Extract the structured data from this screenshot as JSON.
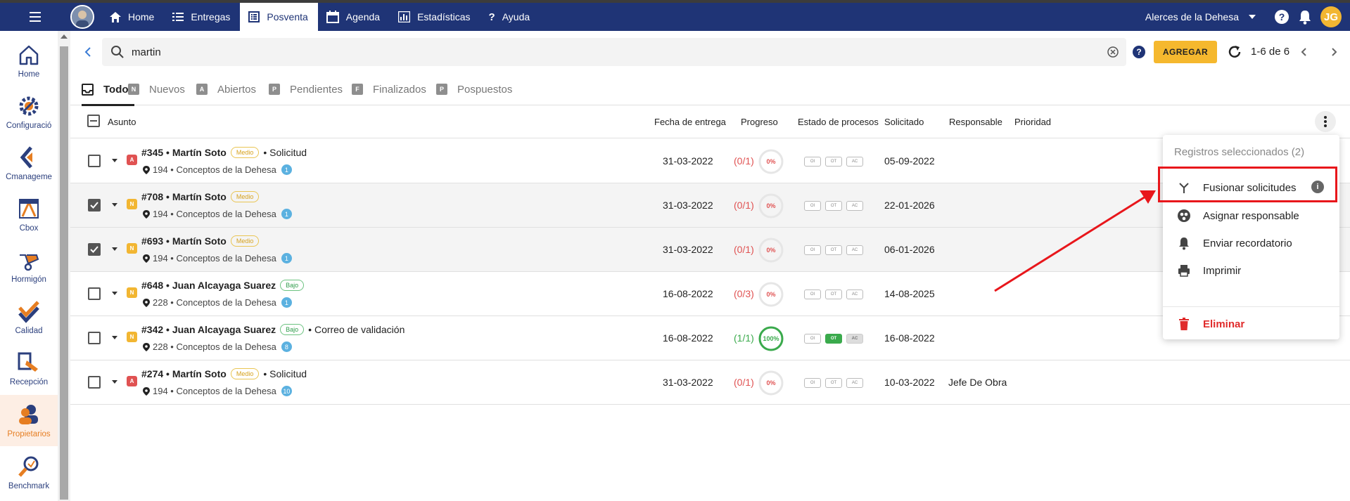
{
  "topbar": {
    "nav": [
      {
        "label": "Home",
        "icon": "home-icon"
      },
      {
        "label": "Entregas",
        "icon": "list-icon"
      },
      {
        "label": "Posventa",
        "icon": "document-icon",
        "active": true
      },
      {
        "label": "Agenda",
        "icon": "calendar-icon"
      },
      {
        "label": "Estadísticas",
        "icon": "chart-icon"
      },
      {
        "label": "Ayuda",
        "icon": "question-icon"
      }
    ],
    "company": "Alerces de la Dehesa",
    "user_initials": "JG",
    "brand_color": "#1f3476"
  },
  "sidebar": {
    "items": [
      {
        "label": "Home"
      },
      {
        "label": "Configuració"
      },
      {
        "label": "Cmanageme"
      },
      {
        "label": "Cbox"
      },
      {
        "label": "Hormigón"
      },
      {
        "label": "Calidad"
      },
      {
        "label": "Recepción"
      },
      {
        "label": "Propietarios",
        "active": true
      },
      {
        "label": "Benchmark"
      }
    ]
  },
  "search": {
    "value": "martin",
    "add_label": "AGREGAR",
    "pager": "1-6 de 6"
  },
  "tabs": [
    {
      "label": "Todos",
      "badge": "",
      "active": true
    },
    {
      "label": "Nuevos",
      "badge": "N"
    },
    {
      "label": "Abiertos",
      "badge": "A"
    },
    {
      "label": "Pendientes",
      "badge": "P"
    },
    {
      "label": "Finalizados",
      "badge": "F"
    },
    {
      "label": "Pospuestos",
      "badge": "P"
    }
  ],
  "columns": {
    "asunto": "Asunto",
    "fecha": "Fecha de entrega",
    "progreso": "Progreso",
    "estado": "Estado de procesos",
    "solicitado": "Solicitado",
    "responsable": "Responsable",
    "prioridad": "Prioridad"
  },
  "rows": [
    {
      "checked": false,
      "prio": "A",
      "id": "#345 • Martín Soto",
      "tag": "Medio",
      "extra": "• Solicitud",
      "unit": "194 • Conceptos de la Dehesa",
      "count": "1",
      "fecha": "31-03-2022",
      "prog_text": "(0/1)",
      "prog_pct": "0%",
      "prog_value": 0,
      "procs": [
        "OI",
        "OT",
        "AC"
      ],
      "proc_states": [
        "off",
        "off",
        "off"
      ],
      "solicitado": "05-09-2022",
      "responsable": ""
    },
    {
      "checked": true,
      "prio": "N",
      "id": "#708 • Martín Soto",
      "tag": "Medio",
      "extra": "",
      "unit": "194 • Conceptos de la Dehesa",
      "count": "1",
      "fecha": "31-03-2022",
      "prog_text": "(0/1)",
      "prog_pct": "0%",
      "prog_value": 0,
      "procs": [
        "OI",
        "OT",
        "AC"
      ],
      "proc_states": [
        "off",
        "off",
        "off"
      ],
      "solicitado": "22-01-2026",
      "responsable": ""
    },
    {
      "checked": true,
      "prio": "N",
      "id": "#693 • Martín Soto",
      "tag": "Medio",
      "extra": "",
      "unit": "194 • Conceptos de la Dehesa",
      "count": "1",
      "fecha": "31-03-2022",
      "prog_text": "(0/1)",
      "prog_pct": "0%",
      "prog_value": 0,
      "procs": [
        "OI",
        "OT",
        "AC"
      ],
      "proc_states": [
        "off",
        "off",
        "off"
      ],
      "solicitado": "06-01-2026",
      "responsable": ""
    },
    {
      "checked": false,
      "prio": "N",
      "id": "#648 • Juan Alcayaga Suarez",
      "tag": "Bajo",
      "extra": "",
      "unit": "228 • Conceptos de la Dehesa",
      "count": "1",
      "fecha": "16-08-2022",
      "prog_text": "(0/3)",
      "prog_pct": "0%",
      "prog_value": 0,
      "procs": [
        "OI",
        "OT",
        "AC"
      ],
      "proc_states": [
        "off",
        "off",
        "off"
      ],
      "solicitado": "14-08-2025",
      "responsable": ""
    },
    {
      "checked": false,
      "prio": "N",
      "id": "#342 • Juan Alcayaga Suarez",
      "tag": "Bajo",
      "extra": "• Correo de validación",
      "unit": "228 • Conceptos de la Dehesa",
      "count": "8",
      "fecha": "16-08-2022",
      "prog_text": "(1/1)",
      "prog_pct": "100%",
      "prog_value": 1,
      "procs": [
        "OI",
        "OT",
        "AC"
      ],
      "proc_states": [
        "off",
        "ok",
        "grey"
      ],
      "solicitado": "16-08-2022",
      "responsable": ""
    },
    {
      "checked": false,
      "prio": "A",
      "id": "#274 • Martín Soto",
      "tag": "Medio",
      "extra": "• Solicitud",
      "unit": "194 • Conceptos de la Dehesa",
      "count": "10",
      "fecha": "31-03-2022",
      "prog_text": "(0/1)",
      "prog_pct": "0%",
      "prog_value": 0,
      "procs": [
        "OI",
        "OT",
        "AC"
      ],
      "proc_states": [
        "off",
        "off",
        "off"
      ],
      "solicitado": "10-03-2022",
      "responsable": "Jefe De Obra"
    }
  ],
  "menu": {
    "header": "Registros seleccionados (2)",
    "items": [
      {
        "label": "Fusionar solicitudes",
        "icon": "merge-icon",
        "info": "i"
      },
      {
        "label": "Asignar responsable",
        "icon": "assign-icon"
      },
      {
        "label": "Enviar recordatorio",
        "icon": "bell-icon"
      },
      {
        "label": "Imprimir",
        "icon": "printer-icon"
      },
      {
        "label": "Eliminar",
        "icon": "trash-icon"
      }
    ]
  },
  "colors": {
    "accent": "#f5b82e",
    "danger": "#e02b2b",
    "success": "#3aaa4c",
    "highlight": "#e8161b"
  }
}
